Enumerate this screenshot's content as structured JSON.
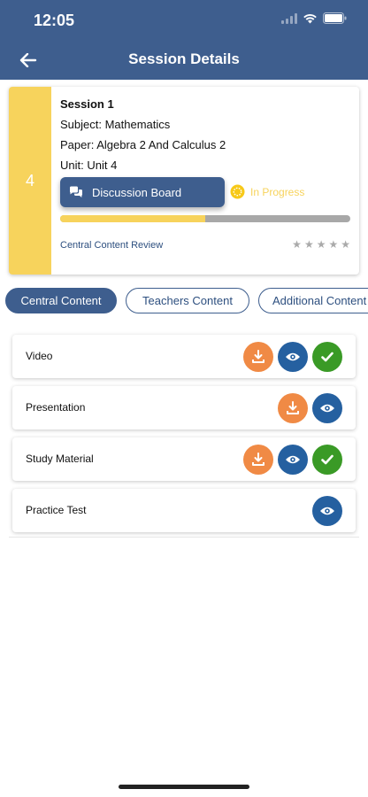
{
  "status_bar": {
    "time": "12:05"
  },
  "header": {
    "title": "Session Details",
    "back_icon": "arrow-left-icon"
  },
  "session": {
    "number": "4",
    "name": "Session 1",
    "subject": "Subject: Mathematics",
    "paper": "Paper: Algebra 2 And Calculus 2",
    "unit": "Unit: Unit 4",
    "discussion_label": "Discussion Board",
    "status_label": "In Progress",
    "progress_fraction": 0.5,
    "review_label": "Central Content Review",
    "rating": 0,
    "rating_max": 5
  },
  "tabs": [
    {
      "label": "Central Content",
      "active": true
    },
    {
      "label": "Teachers Content",
      "active": false
    },
    {
      "label": "Additional Content",
      "active": false
    }
  ],
  "content_items": [
    {
      "label": "Video",
      "actions": [
        "download",
        "view",
        "done"
      ]
    },
    {
      "label": "Presentation",
      "actions": [
        "download",
        "view"
      ]
    },
    {
      "label": "Study Material",
      "actions": [
        "download",
        "view",
        "done"
      ]
    },
    {
      "label": "Practice Test",
      "actions": [
        "view"
      ]
    }
  ],
  "colors": {
    "primary": "#3e5e8e",
    "accent_yellow": "#f7d35c",
    "download_orange": "#f08a45",
    "view_blue": "#2560a0",
    "done_green": "#3a9a26"
  }
}
